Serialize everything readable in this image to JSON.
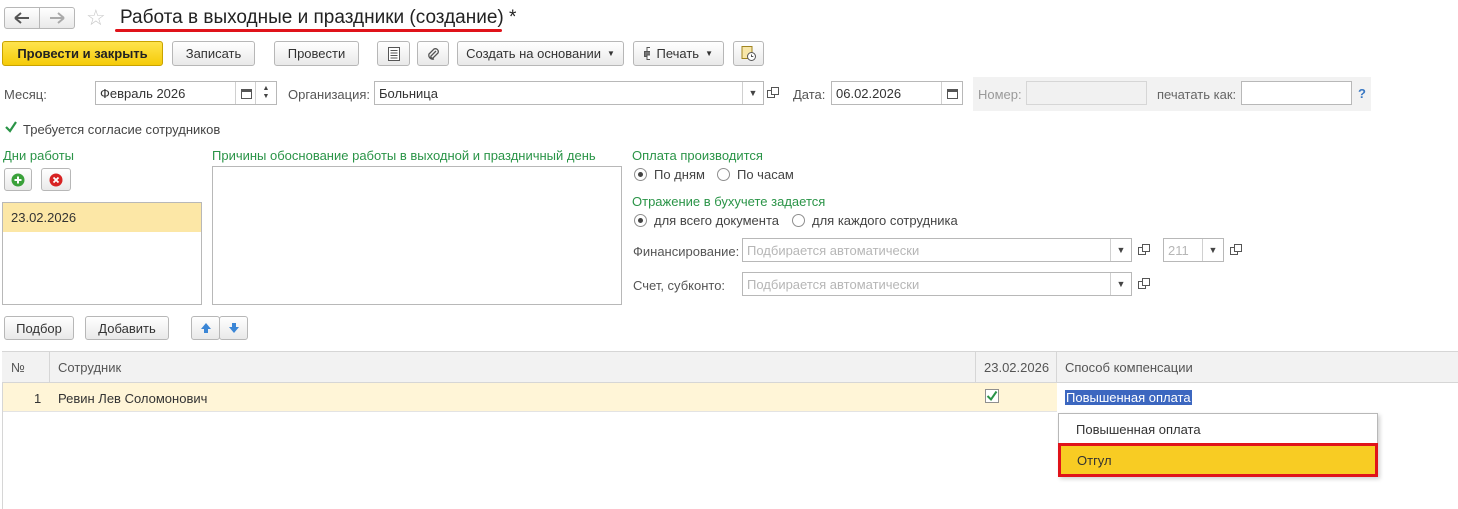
{
  "window": {
    "title": "Работа в выходные и праздники (создание)",
    "modified_mark": "*"
  },
  "toolbar": {
    "post_close": "Провести и закрыть",
    "save": "Записать",
    "post": "Провести",
    "create_based": "Создать на основании",
    "print": "Печать"
  },
  "fields": {
    "month_label": "Месяц:",
    "month_value": "Февраль 2026",
    "org_label": "Организация:",
    "org_value": "Больница",
    "date_label": "Дата:",
    "date_value": "06.02.2026",
    "number_label": "Номер:",
    "number_value": "",
    "print_as_label": "печатать как:",
    "print_as_value": "",
    "help": "?"
  },
  "consent": {
    "label": "Требуется согласие сотрудников",
    "checked": true
  },
  "work_days": {
    "title": "Дни работы",
    "items": [
      "23.02.2026"
    ]
  },
  "reasons": {
    "title": "Причины обоснование работы в выходной и праздничный день",
    "value": ""
  },
  "payment": {
    "title": "Оплата производится",
    "options": [
      "По дням",
      "По часам"
    ],
    "selected": "По дням"
  },
  "accounting": {
    "title": "Отражение в бухучете задается",
    "options": [
      "для всего документа",
      "для каждого сотрудника"
    ],
    "selected": "для всего документа"
  },
  "financing": {
    "label": "Финансирование:",
    "placeholder": "Подбирается автоматически",
    "code": "211"
  },
  "account": {
    "label": "Счет, субконто:",
    "placeholder": "Подбирается автоматически"
  },
  "table_toolbar": {
    "select": "Подбор",
    "add": "Добавить"
  },
  "table": {
    "columns": [
      "№",
      "Сотрудник",
      "23.02.2026",
      "Способ компенсации"
    ],
    "rows": [
      {
        "num": "1",
        "employee": "Ревин Лев Соломонович",
        "checked": true,
        "compensation": "Повышенная оплата"
      }
    ]
  },
  "dropdown": {
    "options": [
      "Повышенная оплата",
      "Отгул"
    ],
    "highlighted": "Отгул"
  },
  "colors": {
    "accent_yellow": "#f5cb08",
    "green_titles": "#2a9447",
    "selection_row": "#fff5d7",
    "highlight_red": "#e0131a"
  }
}
